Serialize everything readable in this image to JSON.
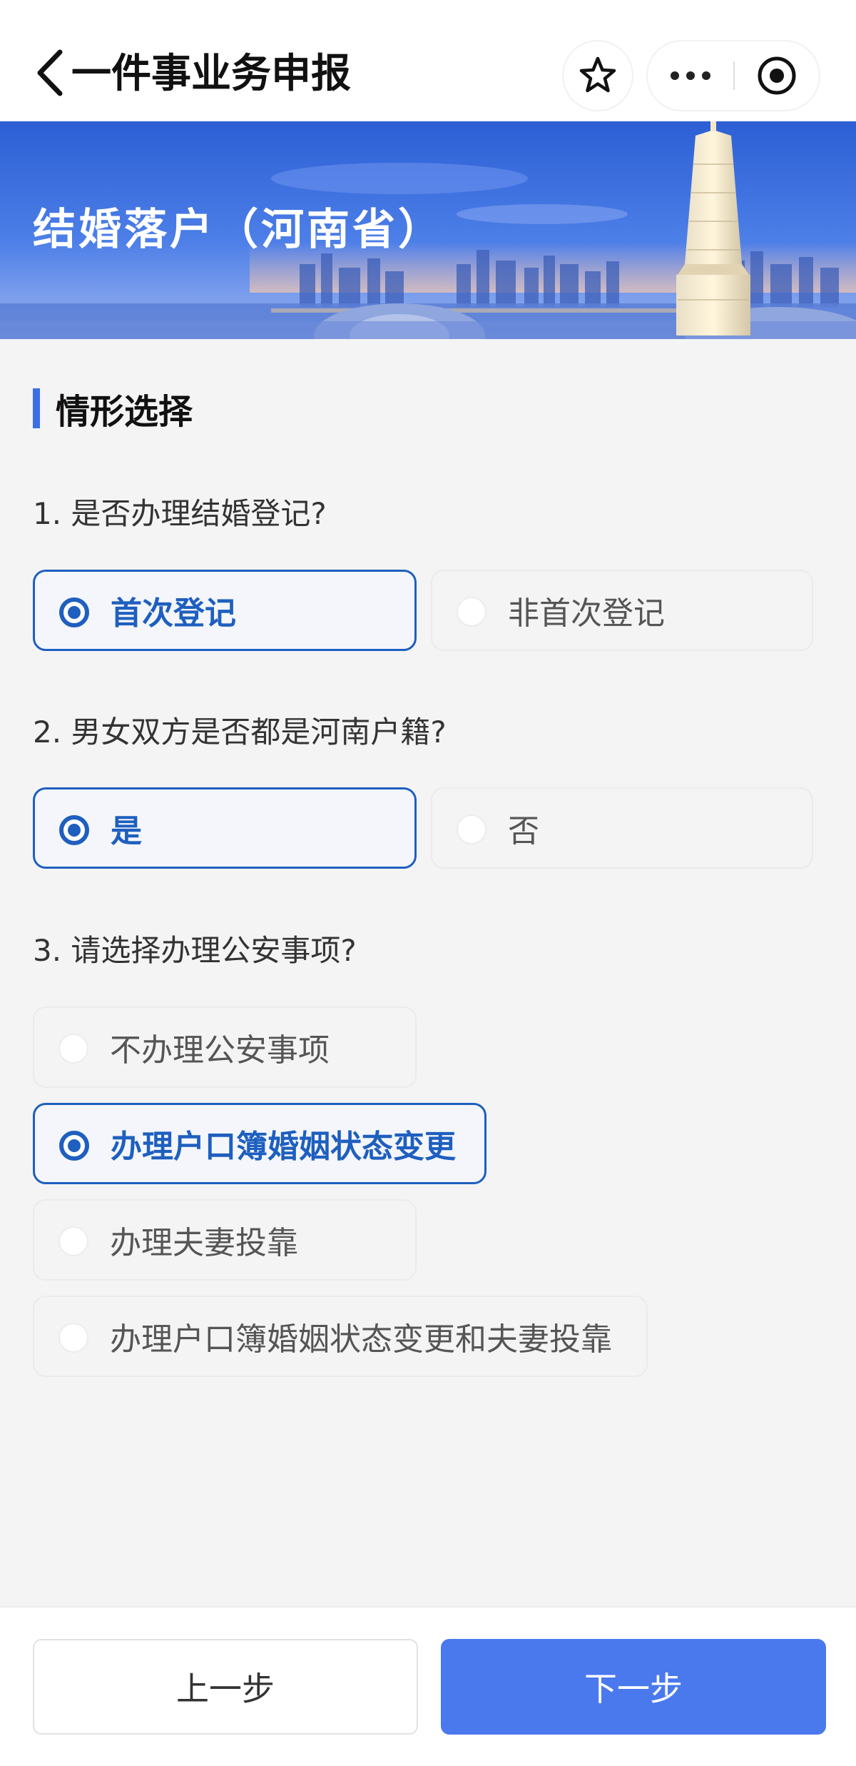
{
  "nav": {
    "title": "一件事业务申报"
  },
  "banner": {
    "title": "结婚落户（河南省）"
  },
  "section": {
    "title": "情形选择"
  },
  "questions": [
    {
      "text": "1. 是否办理结婚登记?",
      "options": [
        {
          "label": "首次登记",
          "selected": true
        },
        {
          "label": "非首次登记",
          "selected": false
        }
      ]
    },
    {
      "text": "2. 男女双方是否都是河南户籍?",
      "options": [
        {
          "label": "是",
          "selected": true
        },
        {
          "label": "否",
          "selected": false
        }
      ]
    },
    {
      "text": "3. 请选择办理公安事项?",
      "options": [
        {
          "label": "不办理公安事项",
          "selected": false
        },
        {
          "label": "办理户口簿婚姻状态变更",
          "selected": true
        },
        {
          "label": "办理夫妻投靠",
          "selected": false
        },
        {
          "label": "办理户口簿婚姻状态变更和夫妻投靠",
          "selected": false
        }
      ]
    }
  ],
  "footer": {
    "prev_label": "上一步",
    "next_label": "下一步"
  },
  "colors": {
    "accent": "#1e5fbf",
    "primary_button": "#4a79ee",
    "section_bar": "#3b6fe6"
  },
  "icons": [
    "chevron-left-icon",
    "star-icon",
    "more-dots-icon",
    "target-icon"
  ]
}
